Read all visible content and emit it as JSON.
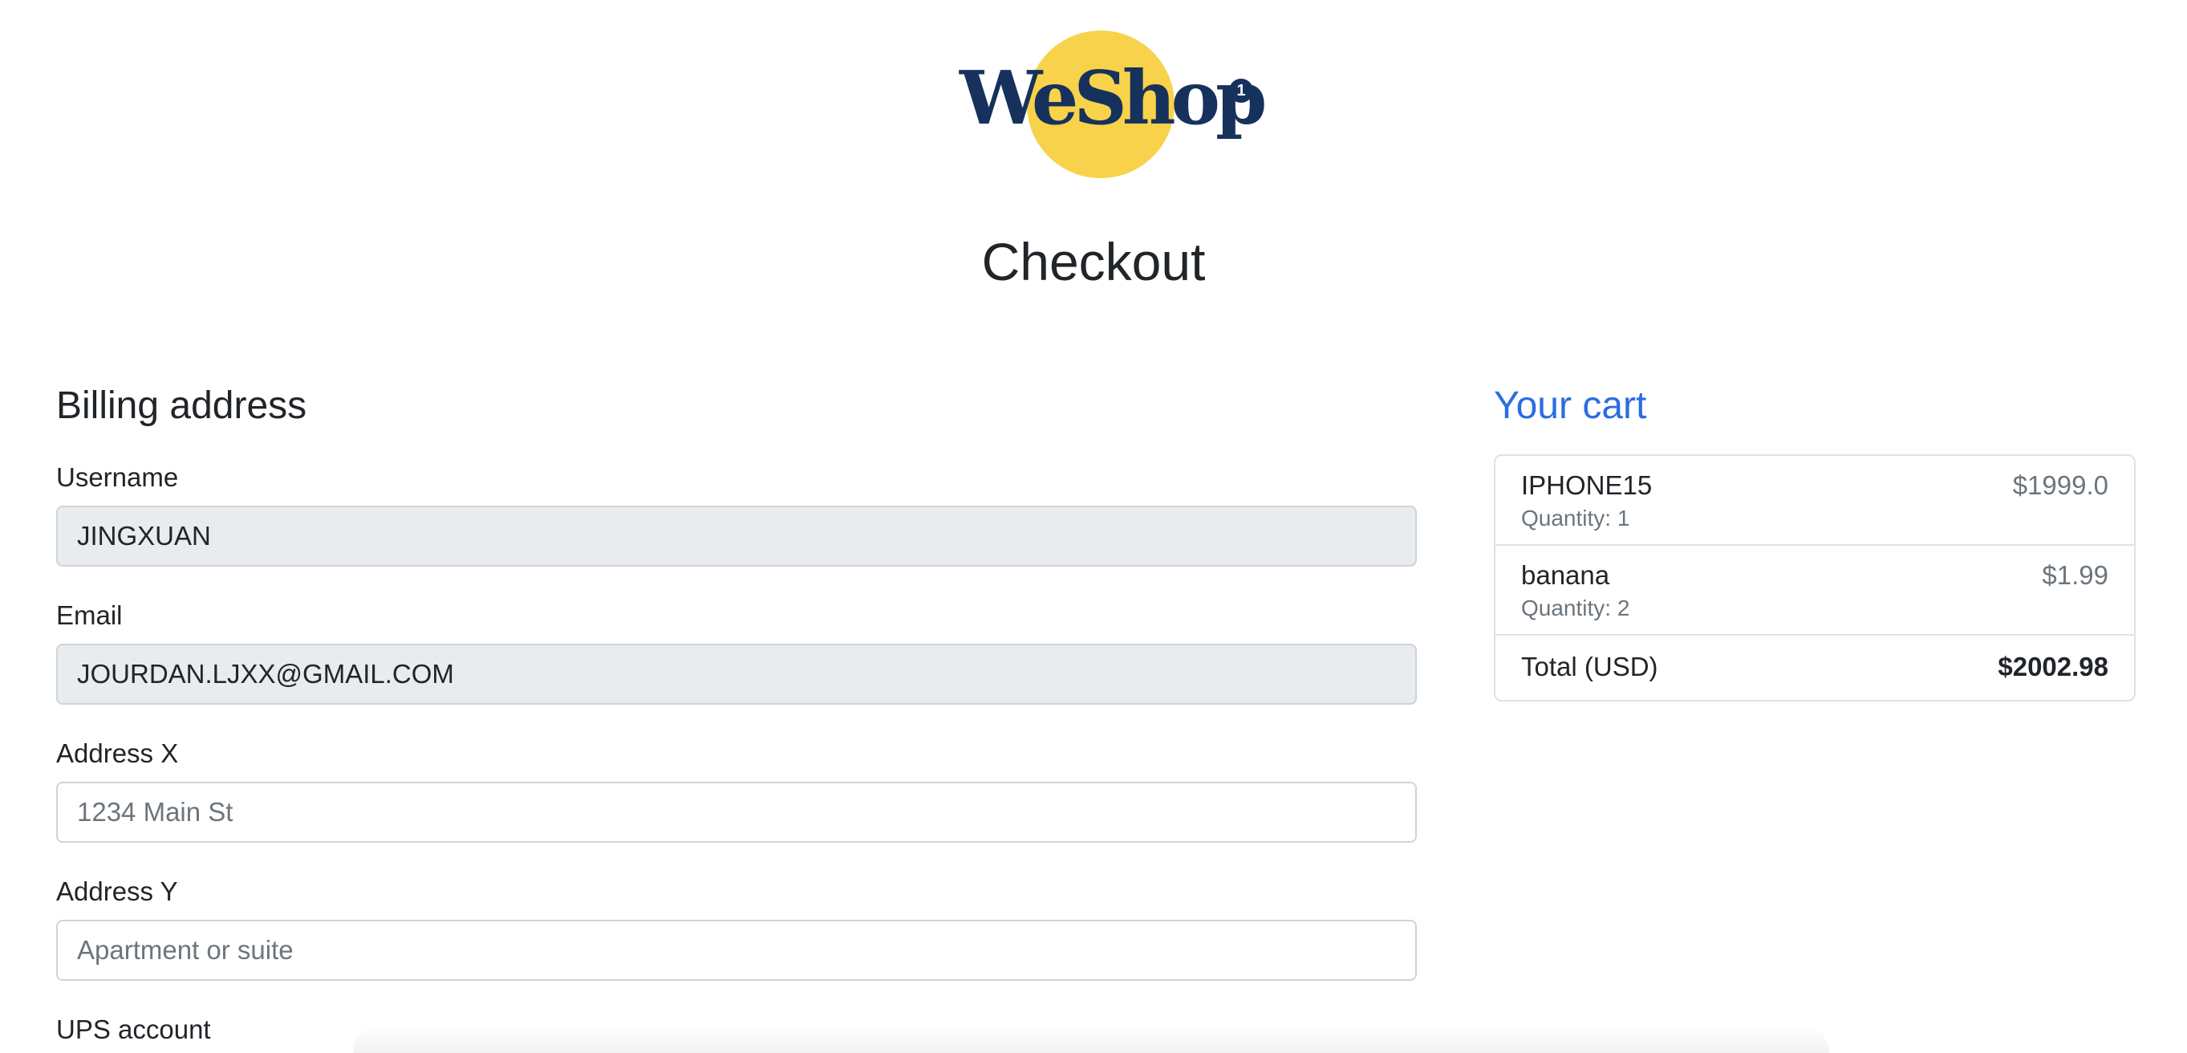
{
  "brand": {
    "logo_text": "WeShop",
    "logo_badge": "1",
    "logo_accent_color": "#f7d24a",
    "logo_text_color": "#16325c"
  },
  "page": {
    "title": "Checkout"
  },
  "billing": {
    "heading": "Billing address",
    "fields": [
      {
        "label": "Username",
        "value": "JINGXUAN",
        "placeholder": "",
        "readonly": true
      },
      {
        "label": "Email",
        "value": "JOURDAN.LJXX@GMAIL.COM",
        "placeholder": "",
        "readonly": true
      },
      {
        "label": "Address X",
        "value": "",
        "placeholder": "1234 Main St",
        "readonly": false
      },
      {
        "label": "Address Y",
        "value": "",
        "placeholder": "Apartment or suite",
        "readonly": false
      },
      {
        "label": "UPS account"
      }
    ]
  },
  "cart": {
    "heading": "Your cart",
    "heading_color": "#2b6de0",
    "items": [
      {
        "name": "IPHONE15",
        "quantity": "Quantity: 1",
        "price": "$1999.0"
      },
      {
        "name": "banana",
        "quantity": "Quantity: 2",
        "price": "$1.99"
      }
    ],
    "total_label": "Total (USD)",
    "total_amount": "$2002.98"
  }
}
